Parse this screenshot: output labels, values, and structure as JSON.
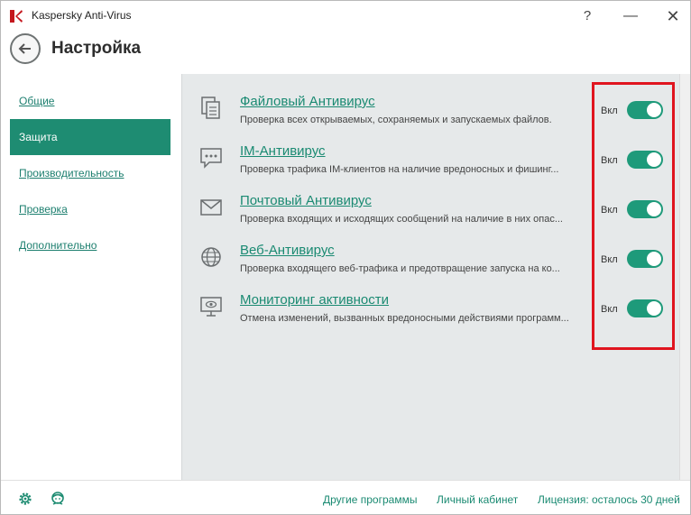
{
  "window": {
    "title": "Kaspersky Anti-Virus",
    "help_glyph": "?",
    "minimize_glyph": "—",
    "close_glyph": "✕"
  },
  "header": {
    "title": "Настройка",
    "back_icon": "back-arrow-icon"
  },
  "sidebar": {
    "items": [
      {
        "label": "Общие",
        "active": false
      },
      {
        "label": "Защита",
        "active": true
      },
      {
        "label": "Производительность",
        "active": false
      },
      {
        "label": "Проверка",
        "active": false
      },
      {
        "label": "Дополнительно",
        "active": false
      }
    ]
  },
  "protection": {
    "components": [
      {
        "name": "Файловый Антивирус",
        "description": "Проверка всех открываемых, сохраняемых и запускаемых файлов.",
        "state": "Вкл",
        "enabled": true,
        "icon": "file-icon"
      },
      {
        "name": "IM-Антивирус",
        "description": "Проверка трафика IM-клиентов на наличие вредоносных и фишинг...",
        "state": "Вкл",
        "enabled": true,
        "icon": "chat-icon"
      },
      {
        "name": "Почтовый Антивирус",
        "description": "Проверка входящих и исходящих сообщений на наличие в них опас...",
        "state": "Вкл",
        "enabled": true,
        "icon": "mail-icon"
      },
      {
        "name": "Веб-Антивирус",
        "description": "Проверка входящего веб-трафика и предотвращение запуска на ко...",
        "state": "Вкл",
        "enabled": true,
        "icon": "globe-icon"
      },
      {
        "name": "Мониторинг активности",
        "description": "Отмена изменений, вызванных вредоносными действиями программ...",
        "state": "Вкл",
        "enabled": true,
        "icon": "monitor-eye-icon"
      }
    ]
  },
  "footer": {
    "settings_icon": "gear-icon",
    "support_icon": "support-agent-icon",
    "links": [
      {
        "label": "Другие программы"
      },
      {
        "label": "Личный кабинет"
      },
      {
        "label": "Лицензия: осталось 30 дней"
      }
    ]
  },
  "colors": {
    "accent": "#1e8c72",
    "toggle_on": "#1e9a7a",
    "highlight": "#e0151f"
  }
}
